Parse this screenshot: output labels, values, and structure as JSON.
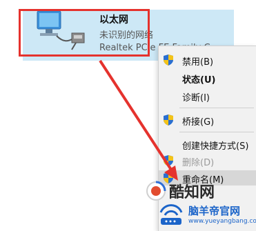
{
  "adapter": {
    "name": "以太网",
    "status": "未识别的网络",
    "device": "Realtek PCIe FE Family C..."
  },
  "context_menu": {
    "items": [
      {
        "label": "禁用(B)",
        "icon": "shield-icon"
      },
      {
        "label": "状态(U)",
        "bold": true
      },
      {
        "label": "诊断(I)"
      },
      {
        "label": "桥接(G)",
        "icon": "shield-icon"
      },
      {
        "label": "创建快捷方式(S)"
      },
      {
        "label": "删除(D)",
        "icon": "shield-icon",
        "disabled": true
      },
      {
        "label": "重命名(M)",
        "icon": "shield-icon",
        "highlighted": true
      }
    ]
  },
  "watermarks": {
    "brand1": "酷知网",
    "brand2": "脑羊帝官网",
    "brand2_url": "www.yueyangbang.com"
  },
  "colors": {
    "selection": "#cde8f6",
    "highlight_border": "#e5322d",
    "arrow": "#e5322d",
    "menu_bg": "#f1f1f1"
  }
}
